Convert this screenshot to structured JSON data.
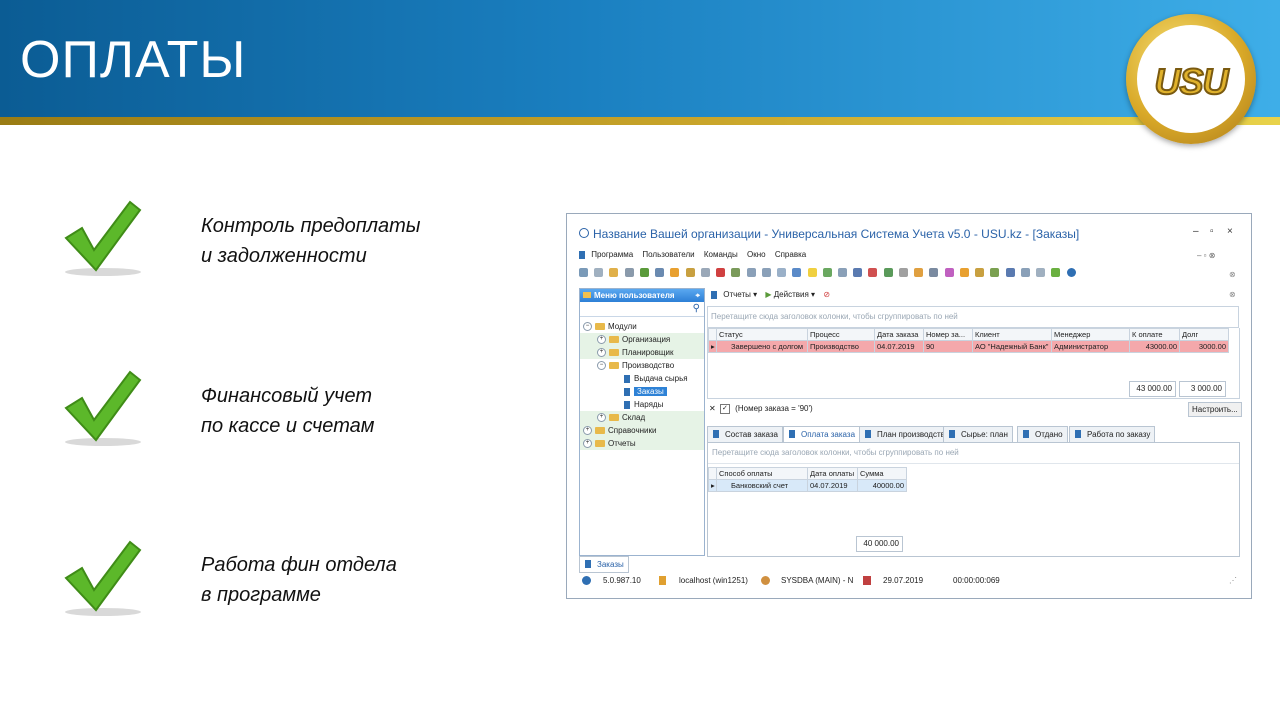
{
  "slide": {
    "title": "ОПЛАТЫ",
    "logo_text": "USU",
    "bullets": [
      {
        "line1": "Контроль предоплаты",
        "line2": "и задолженности"
      },
      {
        "line1": "Финансовый учет",
        "line2": "по кассе и счетам"
      },
      {
        "line1": "Работа фин отдела",
        "line2": "в программе"
      }
    ],
    "colors": {
      "header_blue": "#1a7fc0",
      "stripe_gold": "#c9a52a",
      "check_green": "#5cb82a"
    }
  },
  "app": {
    "window_title": "Название Вашей организации - Универсальная Система Учета v5.0 - USU.kz - [Заказы]",
    "window_controls": [
      "–",
      "▫",
      "×"
    ],
    "menu": [
      "Программа",
      "Пользователи",
      "Команды",
      "Окно",
      "Справка"
    ],
    "sidebar": {
      "title": "Меню пользователя",
      "tree": [
        {
          "label": "Модули",
          "level": 0
        },
        {
          "label": "Организация",
          "level": 1
        },
        {
          "label": "Планировщик",
          "level": 1
        },
        {
          "label": "Производство",
          "level": 1
        },
        {
          "label": "Выдача сырья",
          "level": 2
        },
        {
          "label": "Заказы",
          "level": 2
        },
        {
          "label": "Наряды",
          "level": 2
        },
        {
          "label": "Склад",
          "level": 1
        },
        {
          "label": "Справочники",
          "level": 0
        },
        {
          "label": "Отчеты",
          "level": 0
        }
      ]
    },
    "subtoolbar": {
      "reports": "Отчеты",
      "actions": "Действия"
    },
    "group_hint": "Перетащите сюда заголовок колонки, чтобы сгруппировать по ней",
    "orders": {
      "columns": [
        "Статус",
        "Процесс",
        "Дата заказа",
        "Номер за...",
        "Клиент",
        "Менеджер",
        "К оплате",
        "Долг"
      ],
      "rows": [
        [
          "Завершено с долгом",
          "Производство",
          "04.07.2019",
          "90",
          "АО \"Надежный Банк\"",
          "Администратор",
          "43000.00",
          "3000.00"
        ]
      ],
      "totals": [
        "43 000.00",
        "3 000.00"
      ]
    },
    "filter": {
      "text": "(Номер заказа = '90')",
      "button": "Настроить..."
    },
    "tabs": [
      "Состав заказа",
      "Оплата заказа",
      "План производства",
      "Сырье: план",
      "Отдано",
      "Работа по заказу"
    ],
    "active_tab": "Оплата заказа",
    "payments": {
      "columns": [
        "Способ оплаты",
        "Дата оплаты",
        "Сумма"
      ],
      "rows": [
        [
          "Банковский счет",
          "04.07.2019",
          "40000.00"
        ]
      ],
      "total": "40 000.00"
    },
    "bottom_tab": "Заказы",
    "status": {
      "version": "5.0.987.10",
      "server": "localhost (win1251)",
      "user": "SYSDBA (MAIN) - N",
      "date": "29.07.2019",
      "timer": "00:00:00:069"
    }
  }
}
